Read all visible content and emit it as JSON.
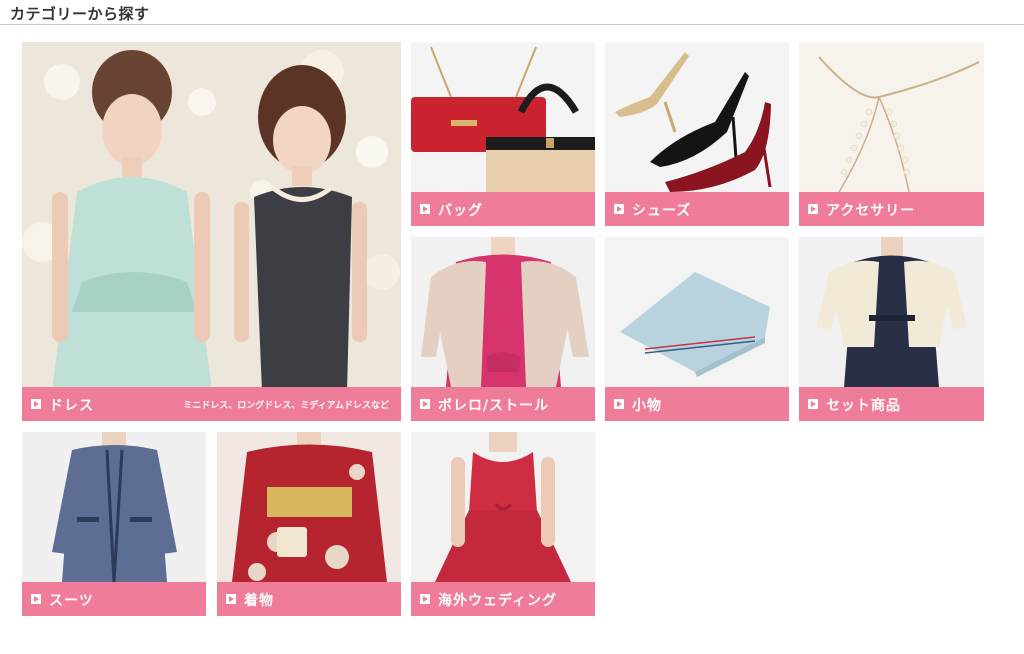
{
  "header": {
    "title": "カテゴリーから探す"
  },
  "categories": [
    {
      "label": "ドレス",
      "sublabel": "ミニドレス、ロングドレス、ミディアムドレスなど",
      "icon": "play-arrow-icon"
    },
    {
      "label": "バッグ",
      "icon": "play-arrow-icon"
    },
    {
      "label": "シューズ",
      "icon": "play-arrow-icon"
    },
    {
      "label": "アクセサリー",
      "icon": "play-arrow-icon"
    },
    {
      "label": "ボレロ/ストール",
      "icon": "play-arrow-icon"
    },
    {
      "label": "小物",
      "icon": "play-arrow-icon"
    },
    {
      "label": "セット商品",
      "icon": "play-arrow-icon"
    },
    {
      "label": "スーツ",
      "icon": "play-arrow-icon"
    },
    {
      "label": "着物",
      "icon": "play-arrow-icon"
    },
    {
      "label": "海外ウェディング",
      "icon": "play-arrow-icon"
    }
  ],
  "colors": {
    "accent": "#ef7c99",
    "header_text": "#333333",
    "divider": "#c9c9c9"
  }
}
